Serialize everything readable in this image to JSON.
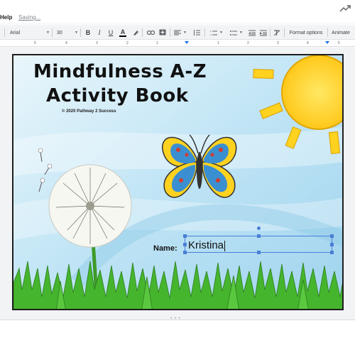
{
  "menubar": {
    "help_label": "Help",
    "status_text": "Saving..."
  },
  "toolbar": {
    "font_family": "Arial",
    "font_size": "30",
    "bold_label": "B",
    "italic_label": "I",
    "underline_label": "U",
    "text_color_label": "A",
    "format_options_label": "Format options",
    "animate_label": "Animate"
  },
  "ruler": {
    "ticks": [
      "5",
      "4",
      "3",
      "2",
      "1",
      "1",
      "2",
      "3",
      "4",
      "5"
    ]
  },
  "slide": {
    "title_line1": "Mindfulness A-Z",
    "title_line2": "Activity Book",
    "copyright": "© 2020 Pathway 2 Success",
    "name_label": "Name:",
    "name_value": "Kristina"
  },
  "colors": {
    "accent": "#1a73e8",
    "sun": "#ffd21f",
    "grass": "#3fae2a",
    "sky": "#bfe4f5"
  }
}
